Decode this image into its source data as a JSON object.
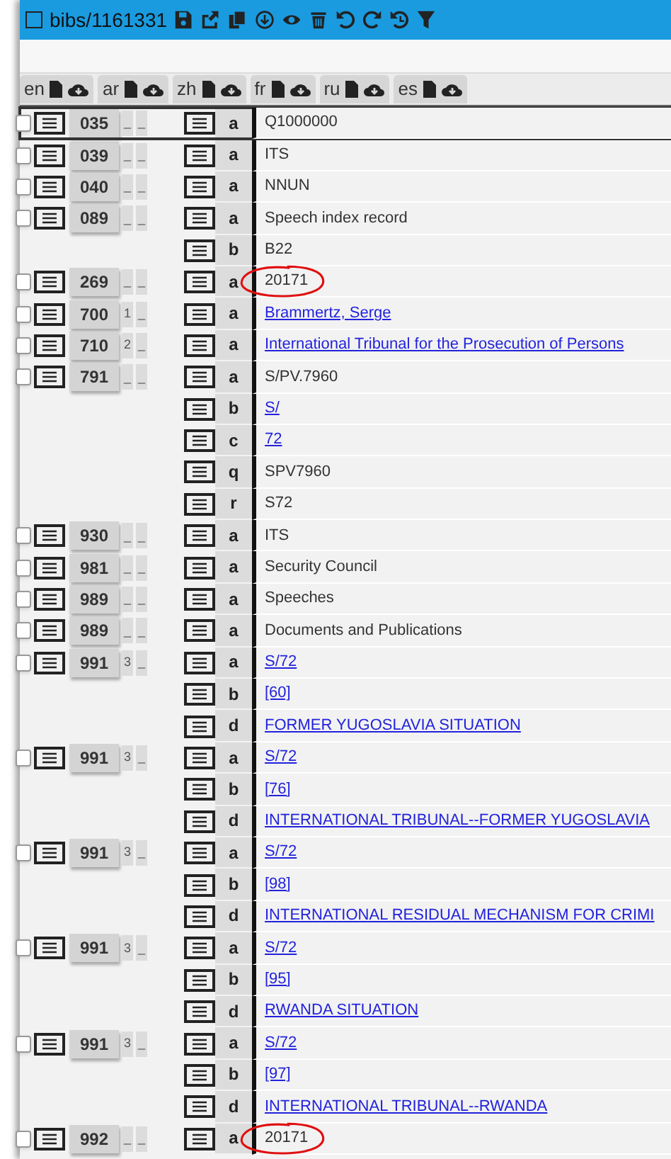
{
  "record": {
    "title": "bibs/1161331",
    "checked": false
  },
  "languages": [
    {
      "label": "en"
    },
    {
      "label": "ar"
    },
    {
      "label": "zh"
    },
    {
      "label": "fr"
    },
    {
      "label": "ru"
    },
    {
      "label": "es"
    }
  ],
  "fields": [
    {
      "tag": "035",
      "ind1": "_",
      "ind2": "_",
      "selected": true,
      "checked": false,
      "subfields": [
        {
          "code": "a",
          "value": "Q1000000",
          "link": false,
          "circled": false
        }
      ]
    },
    {
      "tag": "039",
      "ind1": "_",
      "ind2": "_",
      "selected": false,
      "checked": false,
      "subfields": [
        {
          "code": "a",
          "value": "ITS",
          "link": false,
          "circled": false
        }
      ]
    },
    {
      "tag": "040",
      "ind1": "_",
      "ind2": "_",
      "selected": false,
      "checked": false,
      "subfields": [
        {
          "code": "a",
          "value": "NNUN",
          "link": false,
          "circled": false
        }
      ]
    },
    {
      "tag": "089",
      "ind1": "_",
      "ind2": "_",
      "selected": false,
      "checked": false,
      "subfields": [
        {
          "code": "a",
          "value": "Speech index record",
          "link": false,
          "circled": false
        },
        {
          "code": "b",
          "value": "B22",
          "link": false,
          "circled": false
        }
      ]
    },
    {
      "tag": "269",
      "ind1": "_",
      "ind2": "_",
      "selected": false,
      "checked": false,
      "subfields": [
        {
          "code": "a",
          "value": "20171",
          "link": false,
          "circled": true
        }
      ]
    },
    {
      "tag": "700",
      "ind1": "1",
      "ind2": "_",
      "selected": false,
      "checked": false,
      "subfields": [
        {
          "code": "a",
          "value": "Brammertz, Serge",
          "link": true,
          "circled": false
        }
      ]
    },
    {
      "tag": "710",
      "ind1": "2",
      "ind2": "_",
      "selected": false,
      "checked": false,
      "subfields": [
        {
          "code": "a",
          "value": "International Tribunal for the Prosecution of Persons",
          "link": true,
          "circled": false
        }
      ]
    },
    {
      "tag": "791",
      "ind1": "_",
      "ind2": "_",
      "selected": false,
      "checked": false,
      "subfields": [
        {
          "code": "a",
          "value": "S/PV.7960",
          "link": false,
          "circled": false
        },
        {
          "code": "b",
          "value": "S/",
          "link": true,
          "circled": false
        },
        {
          "code": "c",
          "value": "72",
          "link": true,
          "circled": false
        },
        {
          "code": "q",
          "value": "SPV7960",
          "link": false,
          "circled": false
        },
        {
          "code": "r",
          "value": "S72",
          "link": false,
          "circled": false
        }
      ]
    },
    {
      "tag": "930",
      "ind1": "_",
      "ind2": "_",
      "selected": false,
      "checked": false,
      "subfields": [
        {
          "code": "a",
          "value": "ITS",
          "link": false,
          "circled": false
        }
      ]
    },
    {
      "tag": "981",
      "ind1": "_",
      "ind2": "_",
      "selected": false,
      "checked": false,
      "subfields": [
        {
          "code": "a",
          "value": "Security Council",
          "link": false,
          "circled": false
        }
      ]
    },
    {
      "tag": "989",
      "ind1": "_",
      "ind2": "_",
      "selected": false,
      "checked": false,
      "subfields": [
        {
          "code": "a",
          "value": "Speeches",
          "link": false,
          "circled": false
        }
      ]
    },
    {
      "tag": "989",
      "ind1": "_",
      "ind2": "_",
      "selected": false,
      "checked": false,
      "subfields": [
        {
          "code": "a",
          "value": "Documents and Publications",
          "link": false,
          "circled": false
        }
      ]
    },
    {
      "tag": "991",
      "ind1": "3",
      "ind2": "_",
      "selected": false,
      "checked": false,
      "subfields": [
        {
          "code": "a",
          "value": "S/72",
          "link": true,
          "circled": false
        },
        {
          "code": "b",
          "value": "[60]",
          "link": true,
          "circled": false
        },
        {
          "code": "d",
          "value": "FORMER YUGOSLAVIA SITUATION",
          "link": true,
          "circled": false
        }
      ]
    },
    {
      "tag": "991",
      "ind1": "3",
      "ind2": "_",
      "selected": false,
      "checked": false,
      "subfields": [
        {
          "code": "a",
          "value": "S/72",
          "link": true,
          "circled": false
        },
        {
          "code": "b",
          "value": "[76]",
          "link": true,
          "circled": false
        },
        {
          "code": "d",
          "value": "INTERNATIONAL TRIBUNAL--FORMER YUGOSLAVIA",
          "link": true,
          "circled": false
        }
      ]
    },
    {
      "tag": "991",
      "ind1": "3",
      "ind2": "_",
      "selected": false,
      "checked": false,
      "subfields": [
        {
          "code": "a",
          "value": "S/72",
          "link": true,
          "circled": false
        },
        {
          "code": "b",
          "value": "[98]",
          "link": true,
          "circled": false
        },
        {
          "code": "d",
          "value": "INTERNATIONAL RESIDUAL MECHANISM FOR CRIMI",
          "link": true,
          "circled": false
        }
      ]
    },
    {
      "tag": "991",
      "ind1": "3",
      "ind2": "_",
      "selected": false,
      "checked": false,
      "subfields": [
        {
          "code": "a",
          "value": "S/72",
          "link": true,
          "circled": false
        },
        {
          "code": "b",
          "value": "[95]",
          "link": true,
          "circled": false
        },
        {
          "code": "d",
          "value": "RWANDA SITUATION",
          "link": true,
          "circled": false
        }
      ]
    },
    {
      "tag": "991",
      "ind1": "3",
      "ind2": "_",
      "selected": false,
      "checked": false,
      "subfields": [
        {
          "code": "a",
          "value": "S/72",
          "link": true,
          "circled": false
        },
        {
          "code": "b",
          "value": "[97]",
          "link": true,
          "circled": false
        },
        {
          "code": "d",
          "value": "INTERNATIONAL TRIBUNAL--RWANDA",
          "link": true,
          "circled": false
        }
      ]
    },
    {
      "tag": "992",
      "ind1": "_",
      "ind2": "_",
      "selected": false,
      "checked": false,
      "subfields": [
        {
          "code": "a",
          "value": "20171",
          "link": false,
          "circled": true
        }
      ]
    }
  ]
}
